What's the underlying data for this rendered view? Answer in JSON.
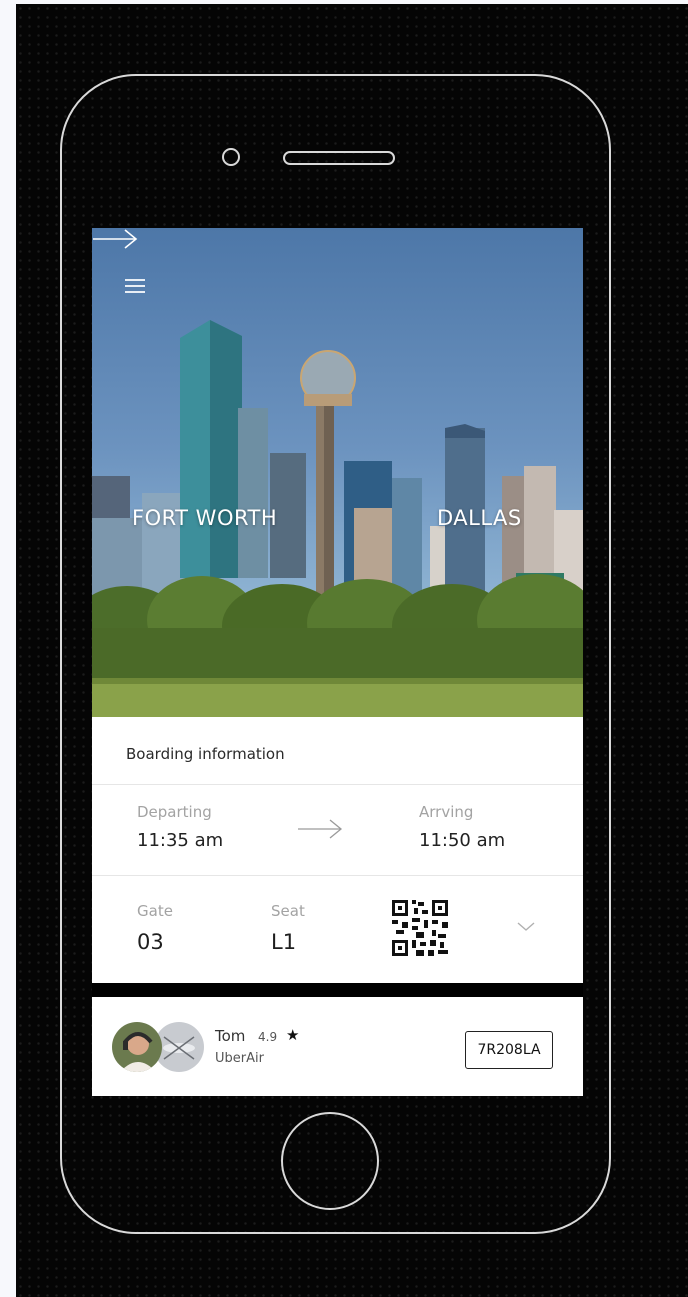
{
  "route": {
    "from": "FORT WORTH",
    "to": "DALLAS"
  },
  "boarding": {
    "title": "Boarding information",
    "departing_label": "Departing",
    "departing_time": "11:35 am",
    "arriving_label": "Arrving",
    "arriving_time": "11:50 am",
    "gate_label": "Gate",
    "gate_value": "03",
    "seat_label": "Seat",
    "seat_value": "L1"
  },
  "driver": {
    "name": "Tom",
    "rating": "4.9",
    "star": "★",
    "company": "UberAir",
    "plate": "7R208LA"
  },
  "icons": {
    "menu": "hamburger-menu-icon",
    "route_arrow": "arrow-right-icon",
    "time_arrow": "arrow-right-icon",
    "qr": "qr-code-icon",
    "expand": "chevron-down-icon",
    "star": "star-icon"
  },
  "colors": {
    "background": "#050505",
    "outline": "#d9d9d9",
    "screen": "#ffffff",
    "label": "#a3a3a3",
    "text": "#222222"
  }
}
